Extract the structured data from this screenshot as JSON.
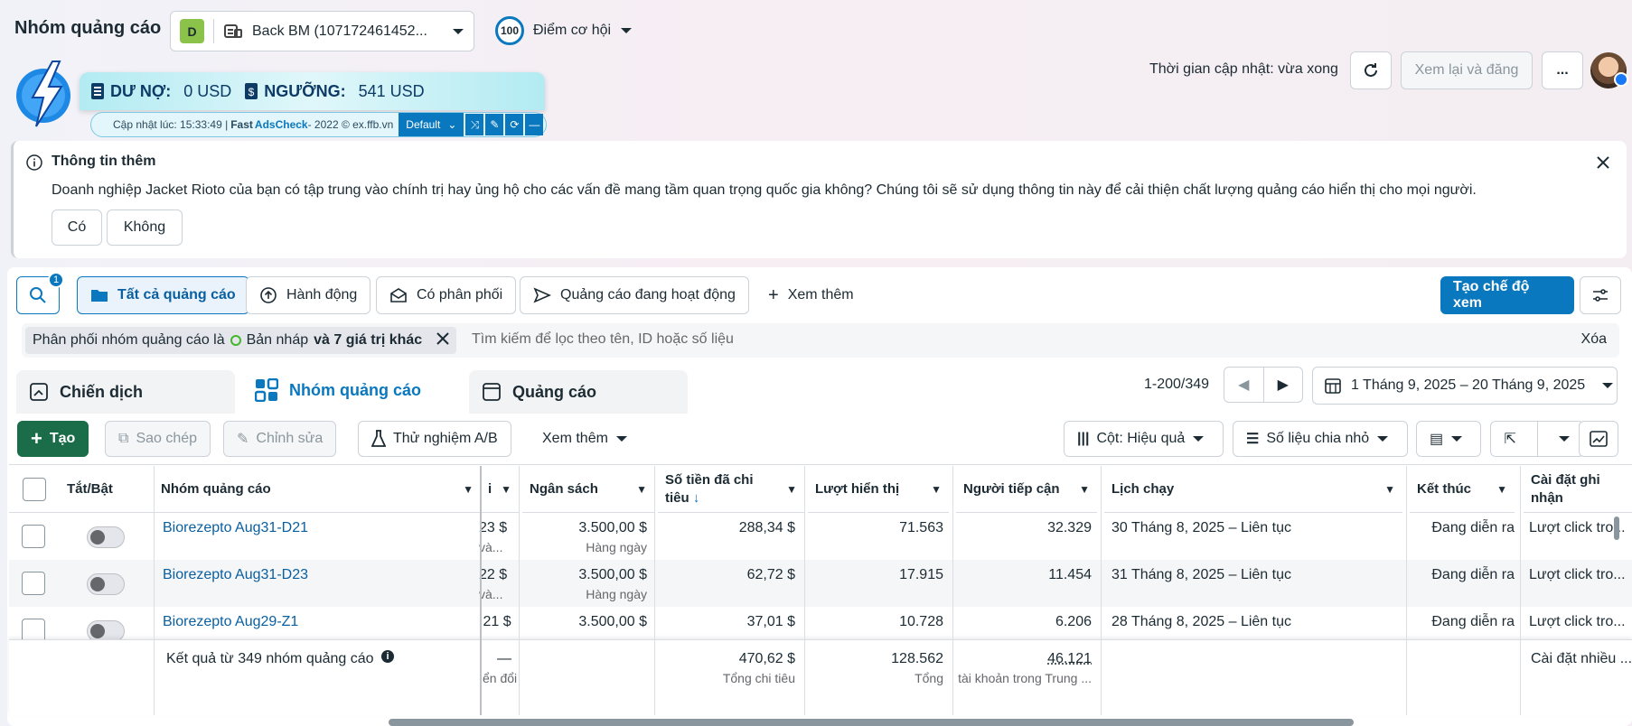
{
  "header": {
    "title": "Nhóm quảng cáo",
    "account_initial": "D",
    "account_name": "Back BM (107172461452...",
    "opportunity_score": "100",
    "opportunity_label": "Điểm cơ hội",
    "updated": "Thời gian cập nhật: vừa xong",
    "review_button": "Xem lại và đăng",
    "more": "..."
  },
  "debt": {
    "debt_label": "DƯ NỢ:",
    "debt_value": "0 USD",
    "threshold_label": "NGƯỠNG:",
    "threshold_value": "541 USD",
    "bar_prefix": "Cập nhật lúc: 15:33:49 | ",
    "bar_brand1": "Fast ",
    "bar_brand2": "AdsCheck",
    "bar_suffix": " - 2022 © ex.ffb.vn",
    "preset": "Default"
  },
  "info": {
    "title": "Thông tin thêm",
    "text": "Doanh nghiệp Jacket Rioto của bạn có tập trung vào chính trị hay ủng hộ cho các vấn đề mang tầm quan trọng quốc gia không? Chúng tôi sẽ sử dụng thông tin này để cải thiện chất lượng quảng cáo hiển thị cho mọi người.",
    "yes": "Có",
    "no": "Không"
  },
  "toolbar": {
    "search_badge": "1",
    "all_ads": "Tất cả quảng cáo",
    "actions": "Hành động",
    "delivery": "Có phân phối",
    "active_ads": "Quảng cáo đang hoạt động",
    "see_more": "Xem thêm",
    "create_view": "Tạo chế độ xem"
  },
  "filter": {
    "chip_text": "Phân phối nhóm quảng cáo là",
    "chip_value": "Bản nháp",
    "chip_more": "và 7 giá trị khác",
    "placeholder": "Tìm kiếm để lọc theo tên, ID hoặc số liệu",
    "clear": "Xóa"
  },
  "tabs": {
    "campaign": "Chiến dịch",
    "adset": "Nhóm quảng cáo",
    "ad": "Quảng cáo"
  },
  "pagination": {
    "range": "1-200/349",
    "date_range": "1 Tháng 9, 2025 – 20 Tháng 9, 2025"
  },
  "actions": {
    "create": "Tạo",
    "copy": "Sao chép",
    "edit": "Chỉnh sửa",
    "ab_test": "Thử nghiệm A/B",
    "see_more": "Xem thêm",
    "columns": "Cột: Hiệu quả",
    "breakdown": "Số liệu chia nhỏ"
  },
  "columns": {
    "toggle": "Tắt/Bật",
    "name": "Nhóm quảng cáo",
    "budget": "Ngân sách",
    "spent1": "Số tiền đã chi",
    "spent2": "tiêu",
    "impressions": "Lượt hiển thị",
    "reach": "Người tiếp cận",
    "schedule": "Lịch chạy",
    "end": "Kết thúc",
    "attribution1": "Cài đặt ghi",
    "attribution2": "nhận",
    "partial": "i"
  },
  "rows": [
    {
      "name": "Biorezepto Aug31-D21",
      "partial": "23 $",
      "partial_sub": "và...",
      "budget": "3.500,00 $",
      "budget_sub": "Hàng ngày",
      "spent": "288,34 $",
      "impressions": "71.563",
      "reach": "32.329",
      "schedule": "30 Tháng 8, 2025 – Liên tục",
      "end": "Đang diễn ra",
      "attribution": "Lượt click tro..."
    },
    {
      "name": "Biorezepto Aug31-D23",
      "partial": "22 $",
      "partial_sub": "và...",
      "budget": "3.500,00 $",
      "budget_sub": "Hàng ngày",
      "spent": "62,72 $",
      "impressions": "17.915",
      "reach": "11.454",
      "schedule": "31 Tháng 8, 2025 – Liên tục",
      "end": "Đang diễn ra",
      "attribution": "Lượt click tro..."
    },
    {
      "name": "Biorezepto Aug29-Z1",
      "partial": ",21 $",
      "partial_sub": "",
      "budget": "3.500,00 $",
      "budget_sub": "",
      "spent": "37,01 $",
      "impressions": "10.728",
      "reach": "6.206",
      "schedule": "28 Tháng 8, 2025 – Liên tục",
      "end": "Đang diễn ra",
      "attribution": "Lượt click tro..."
    }
  ],
  "totals": {
    "label": "Kết quả từ 349 nhóm quảng cáo",
    "partial": "—",
    "partial_sub": "ển đổi",
    "spent": "470,62 $",
    "spent_sub": "Tổng chi tiêu",
    "impressions": "128.562",
    "impressions_sub": "Tổng",
    "reach": "46.121",
    "reach_sub": "tài khoản trong Trung ...",
    "attribution": "Cài đặt nhiều ..."
  }
}
